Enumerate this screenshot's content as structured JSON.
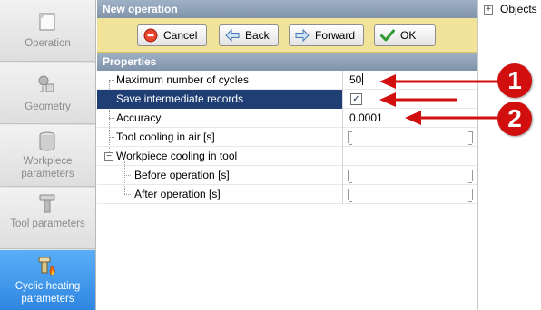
{
  "sidebar": {
    "items": [
      {
        "label": "Operation",
        "icon": "operation-icon",
        "active": false
      },
      {
        "label": "Geometry",
        "icon": "geometry-icon",
        "active": false
      },
      {
        "label": "Workpiece parameters",
        "icon": "workpiece-icon",
        "active": false
      },
      {
        "label": "Tool parameters",
        "icon": "tool-icon",
        "active": false
      },
      {
        "label": "Cyclic heating parameters",
        "icon": "cyclic-heating-icon",
        "active": true
      }
    ]
  },
  "header": {
    "title": "New operation"
  },
  "toolbar": {
    "cancel_label": "Cancel",
    "back_label": "Back",
    "forward_label": "Forward",
    "ok_label": "OK"
  },
  "properties": {
    "title": "Properties",
    "rows": [
      {
        "name": "Maximum number of cycles",
        "value": "50"
      },
      {
        "name": "Save intermediate records",
        "value": "✓"
      },
      {
        "name": "Accuracy",
        "value": "0.0001"
      },
      {
        "name": "Tool cooling in air [s]",
        "value": ""
      },
      {
        "name": "Workpiece cooling in tool",
        "value": ""
      },
      {
        "name": "Before operation [s]",
        "value": ""
      },
      {
        "name": "After operation [s]",
        "value": ""
      }
    ],
    "collapse_glyph": "−"
  },
  "right_panel": {
    "expand_glyph": "+",
    "label": "Objects"
  },
  "annotations": {
    "badge_1": "1",
    "badge_2": "2",
    "color": "#d10f0f"
  }
}
